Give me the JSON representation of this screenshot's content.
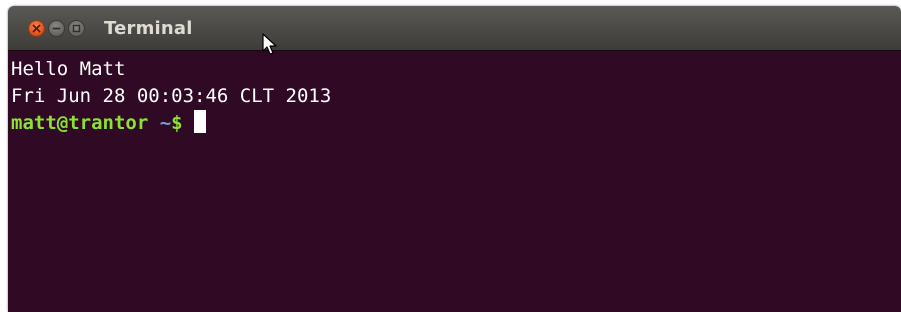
{
  "window": {
    "title": "Terminal",
    "controls": [
      {
        "name": "close",
        "icon": "close-icon"
      },
      {
        "name": "minimize",
        "icon": "minimize-icon"
      },
      {
        "name": "maximize",
        "icon": "maximize-icon"
      }
    ]
  },
  "terminal": {
    "lines": [
      "Hello Matt",
      "Fri Jun 28 00:03:46 CLT 2013"
    ],
    "prompt": {
      "user_host": "matt@trantor",
      "path": " ~",
      "symbol": "$"
    }
  },
  "colors": {
    "terminal_bg": "#300a24",
    "text": "#ffffff",
    "prompt_user": "#8ae234",
    "close_button": "#e0551f",
    "titlebar": "#3d3c38"
  }
}
